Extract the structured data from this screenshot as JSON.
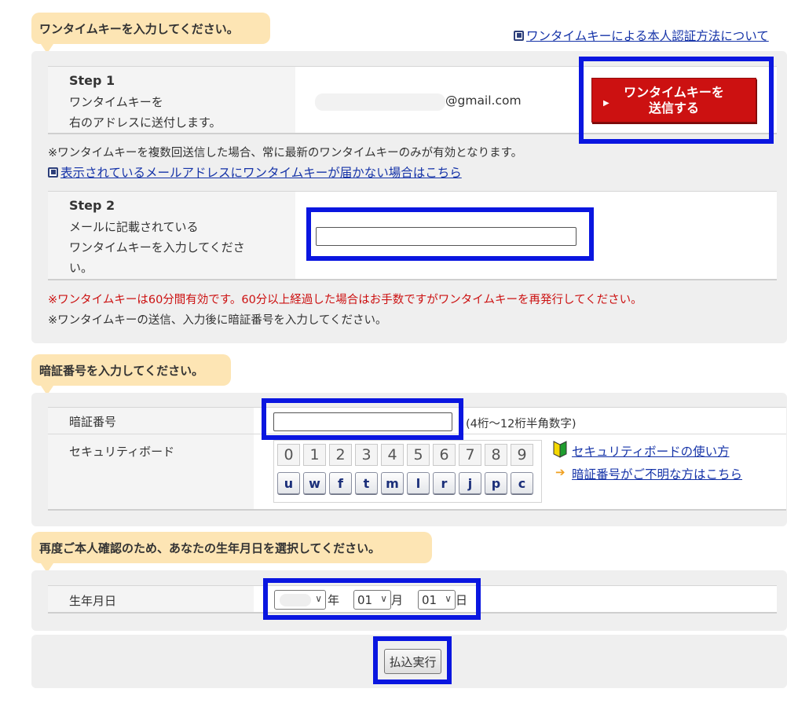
{
  "otp": {
    "heading": "ワンタイムキーを入力してください。",
    "auth_link": "ワンタイムキーによる本人認証方法について",
    "step1": {
      "title": "Step 1",
      "desc_line1": "ワンタイムキーを",
      "desc_line2": "右のアドレスに送付します。",
      "email_suffix": "@gmail.com",
      "send_button_line1": "ワンタイムキーを",
      "send_button_line2": "送信する"
    },
    "note_multiple": "※ワンタイムキーを複数回送信した場合、常に最新のワンタイムキーのみが有効となります。",
    "not_received_link": "表示されているメールアドレスにワンタイムキーが届かない場合はこちら",
    "step2": {
      "title": "Step 2",
      "desc_line1": "メールに記載されている",
      "desc_line2": "ワンタイムキーを入力してくださ",
      "desc_line3": "い。",
      "input_value": ""
    },
    "note_valid": "※ワンタイムキーは60分間有効です。60分以上経過した場合はお手数ですがワンタイムキーを再発行してください。",
    "note_order": "※ワンタイムキーの送信、入力後に暗証番号を入力してください。"
  },
  "pin": {
    "heading": "暗証番号を入力してください。",
    "label": "暗証番号",
    "input_value": "",
    "hint": "(4桁〜12桁半角数字)",
    "board_label": "セキュリティボード",
    "digits": [
      "0",
      "1",
      "2",
      "3",
      "4",
      "5",
      "6",
      "7",
      "8",
      "9"
    ],
    "letters": [
      "u",
      "w",
      "f",
      "t",
      "m",
      "l",
      "r",
      "j",
      "p",
      "c"
    ],
    "board_help_link": "セキュリティボードの使い方",
    "forgot_link": "暗証番号がご不明な方はこちら"
  },
  "dob": {
    "heading": "再度ご本人確認のため、あなたの生年月日を選択してください。",
    "label": "生年月日",
    "year_value": "",
    "year_unit": "年",
    "month_value": "01",
    "month_unit": "月",
    "day_value": "01",
    "day_unit": "日"
  },
  "submit_label": "払込実行",
  "colors": {
    "highlight": "#0a16e0",
    "send_button": "#cc1111",
    "label_bubble": "#fde5b4",
    "panel": "#efefef",
    "link": "#1533a8",
    "warning": "#cc1111"
  }
}
